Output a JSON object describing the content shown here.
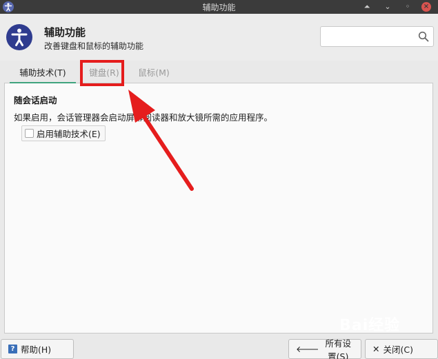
{
  "window": {
    "title": "辅助功能",
    "buttons": [
      "shade",
      "minimize",
      "maximize",
      "close"
    ]
  },
  "header": {
    "title": "辅助功能",
    "subtitle": "改善键盘和鼠标的辅助功能",
    "icon": "accessibility-icon",
    "search": {
      "placeholder": "",
      "value": ""
    }
  },
  "tabs": [
    {
      "label": "辅助技术(T)",
      "active": true
    },
    {
      "label": "键盘(R)",
      "active": false
    },
    {
      "label": "鼠标(M)",
      "active": false
    }
  ],
  "content": {
    "section_title": "随会话启动",
    "description": "如果启用，会话管理器会启动屏幕阅读器和放大镜所需的应用程序。",
    "checkbox": {
      "label": "启用辅助技术(E)",
      "checked": false
    }
  },
  "footer": {
    "help_label": "帮助(H)",
    "all_settings_label": "所有设置(S)",
    "close_label": "关闭(C)"
  },
  "annotation": {
    "highlight_color": "#e51d1d"
  },
  "watermark": "Bai经验",
  "colors": {
    "titlebar": "#3b3b3b",
    "accent": "#3fa37e",
    "icon_bg": "#2f3c8f"
  }
}
